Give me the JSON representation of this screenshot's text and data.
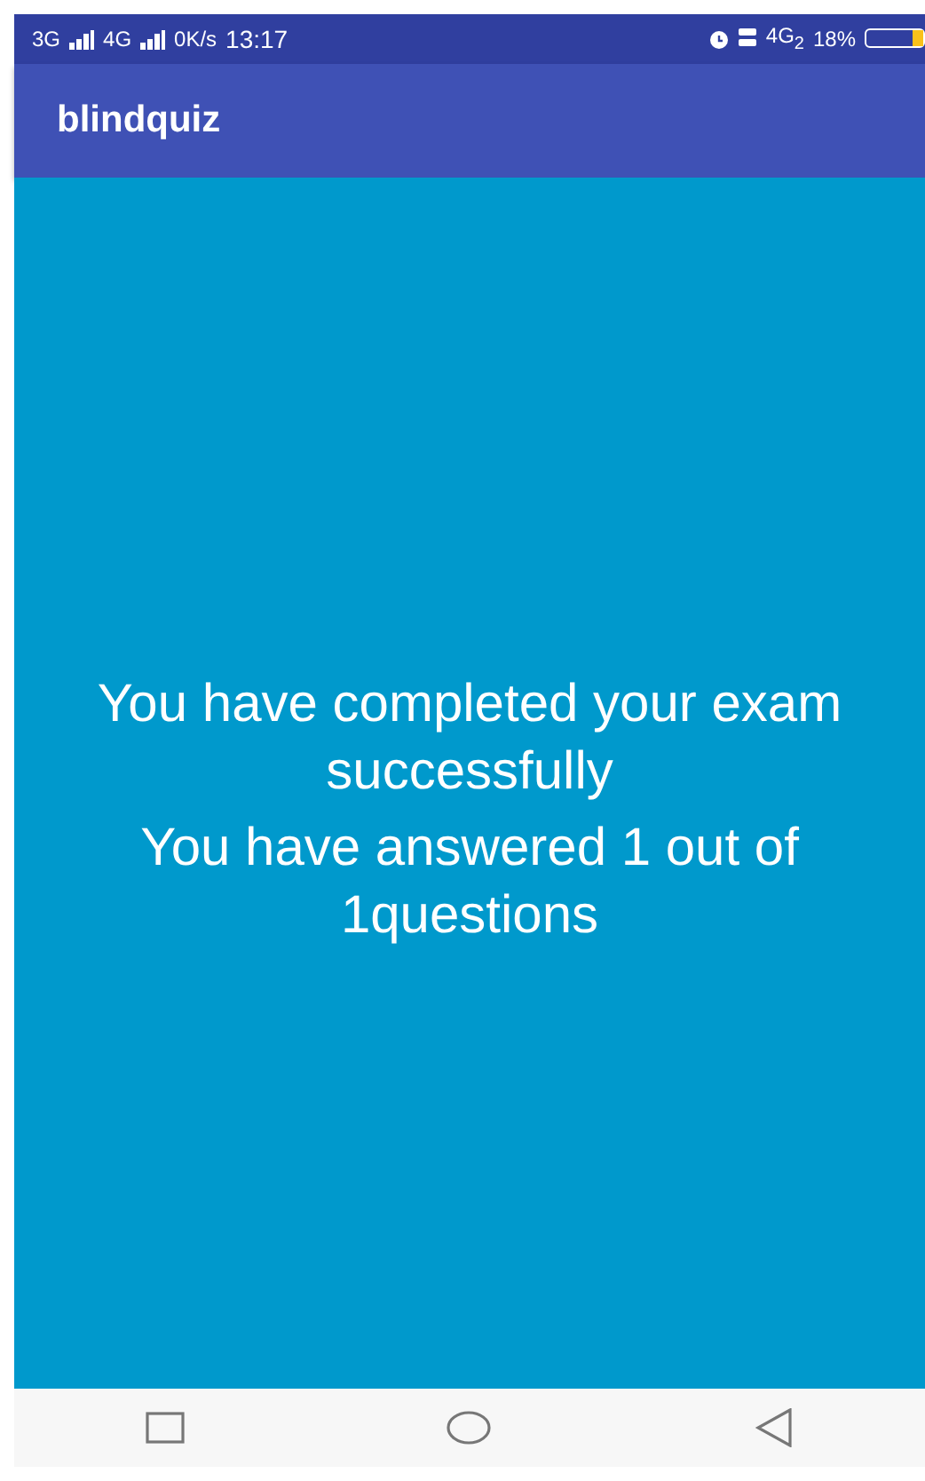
{
  "status_bar": {
    "left": [
      "3G",
      "4G",
      "0K/s"
    ],
    "time": "13:17",
    "network": "4G$_{2}$",
    "battery_text": "18%",
    "battery": {
      "level": 0.18
    }
  },
  "app_bar": {
    "title": "blindquiz"
  },
  "content": {
    "messages": [
      "You have completed your exam successfully",
      "You have answered 1 out of 1questions"
    ]
  }
}
